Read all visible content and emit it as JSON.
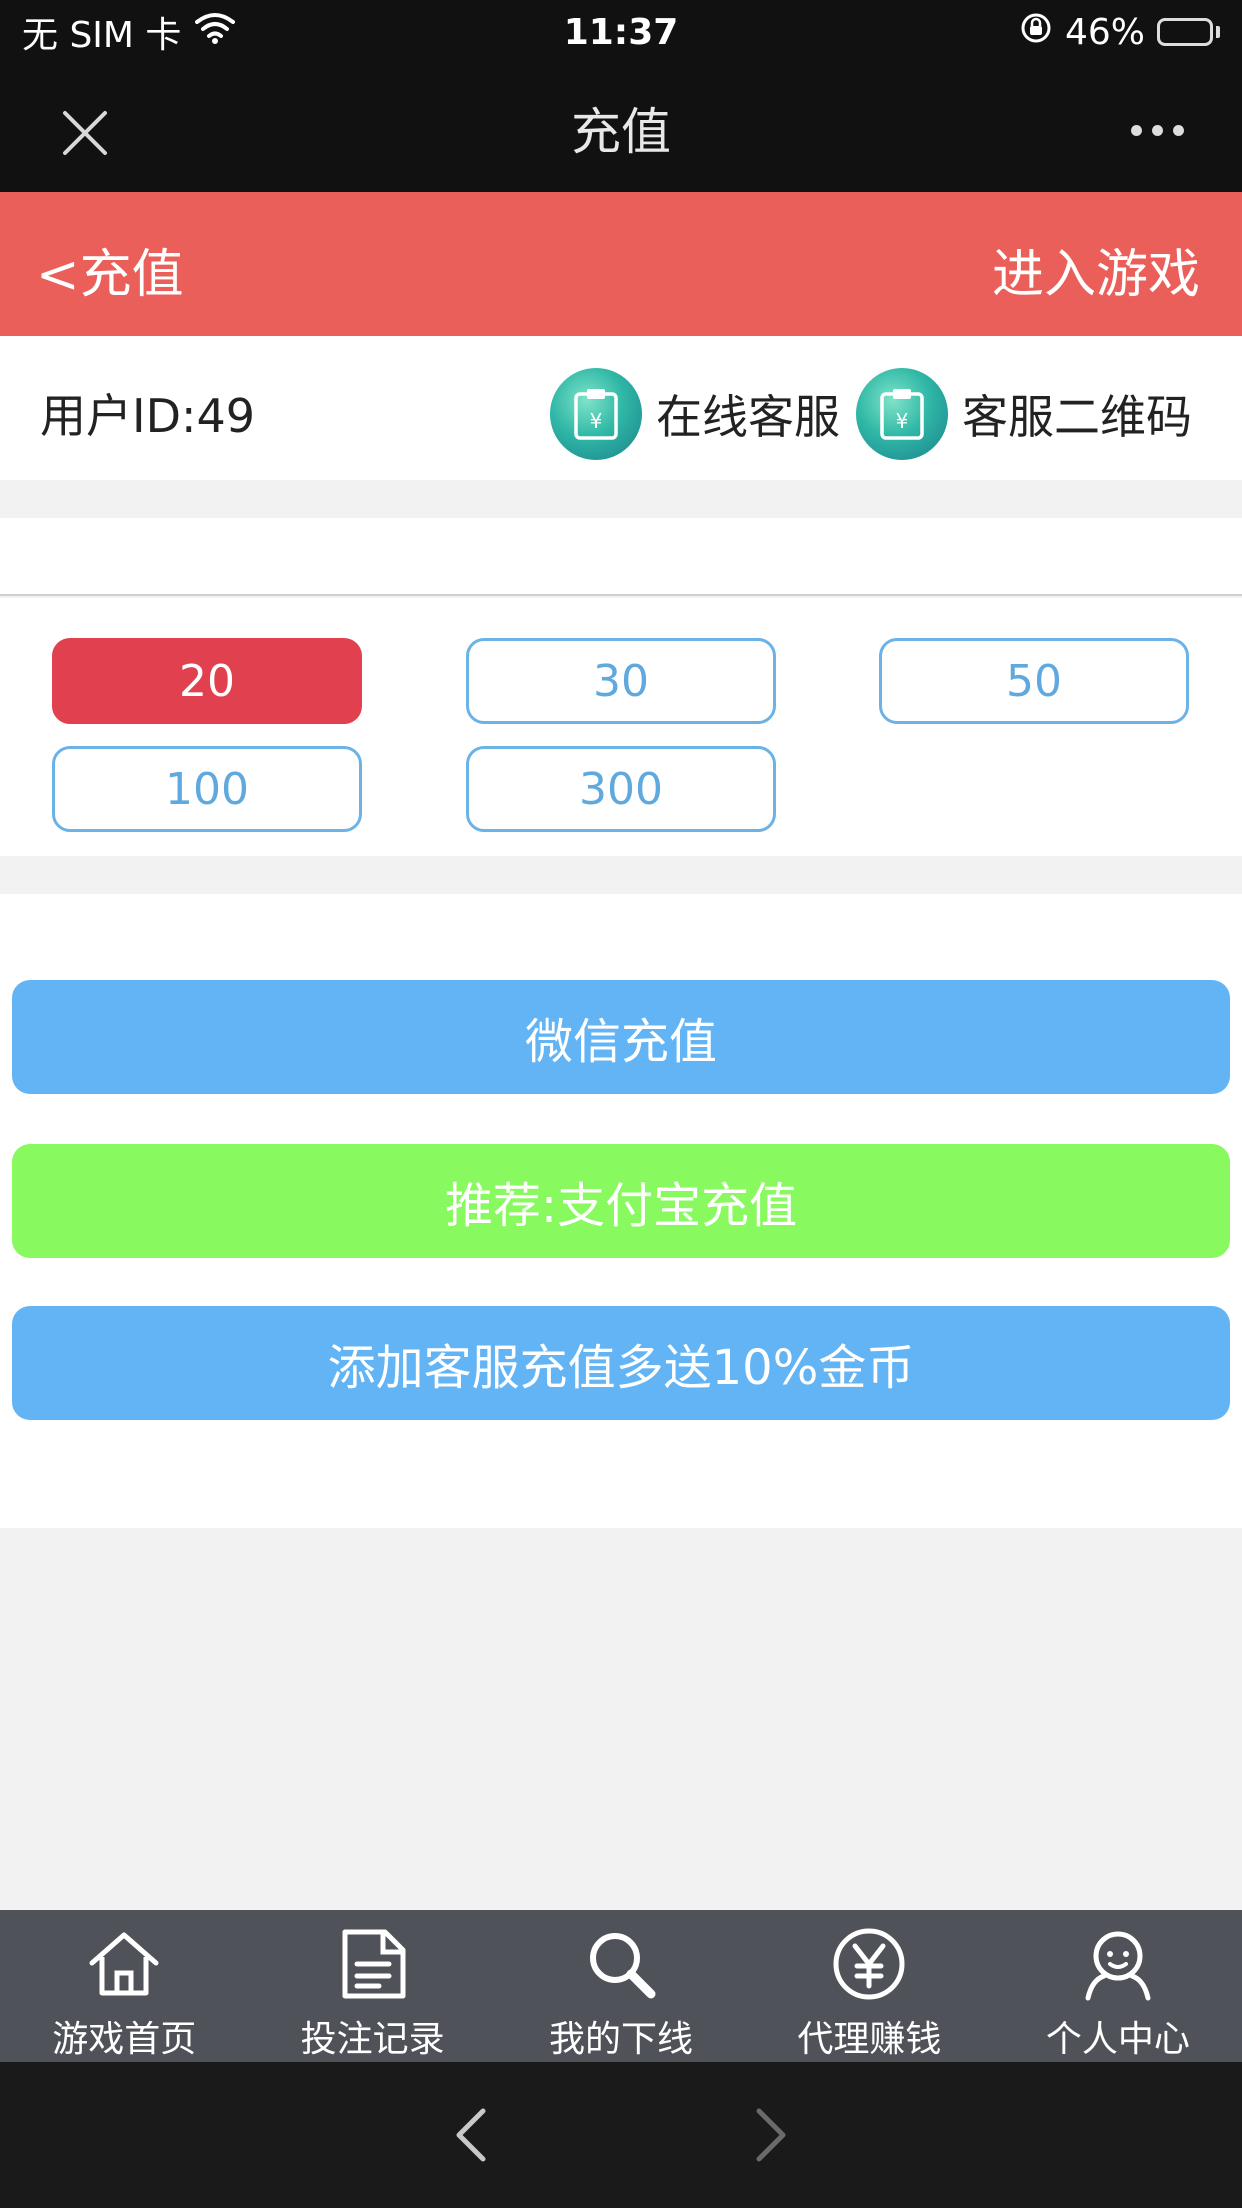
{
  "status_bar": {
    "carrier": "无 SIM 卡",
    "time": "11:37",
    "battery_percent": "46%",
    "battery_level": 0.46
  },
  "nav": {
    "title": "充值",
    "close_icon": "close-icon",
    "more_icon": "more-icon"
  },
  "header": {
    "back_label": "<充值",
    "enter_game_label": "进入游戏",
    "color": "#ea5f59"
  },
  "user": {
    "id_label": "用户ID:49",
    "online_service_label": "在线客服",
    "service_qr_label": "客服二维码"
  },
  "amounts": {
    "items": [
      "20",
      "30",
      "50",
      "100",
      "300"
    ],
    "selected": "20",
    "active_color": "#e1404e",
    "border_color": "#6bb3e6"
  },
  "payment": {
    "wechat_label": "微信充值",
    "alipay_label": "推荐:支付宝充值",
    "service_label": "添加客服充值多送10%金币",
    "wechat_color": "#63b4f5",
    "alipay_color": "#88f95e"
  },
  "tabs": [
    {
      "label": "游戏首页",
      "icon": "home-icon"
    },
    {
      "label": "投注记录",
      "icon": "document-icon"
    },
    {
      "label": "我的下线",
      "icon": "search-icon"
    },
    {
      "label": "代理赚钱",
      "icon": "yen-icon"
    },
    {
      "label": "个人中心",
      "icon": "user-icon"
    }
  ]
}
